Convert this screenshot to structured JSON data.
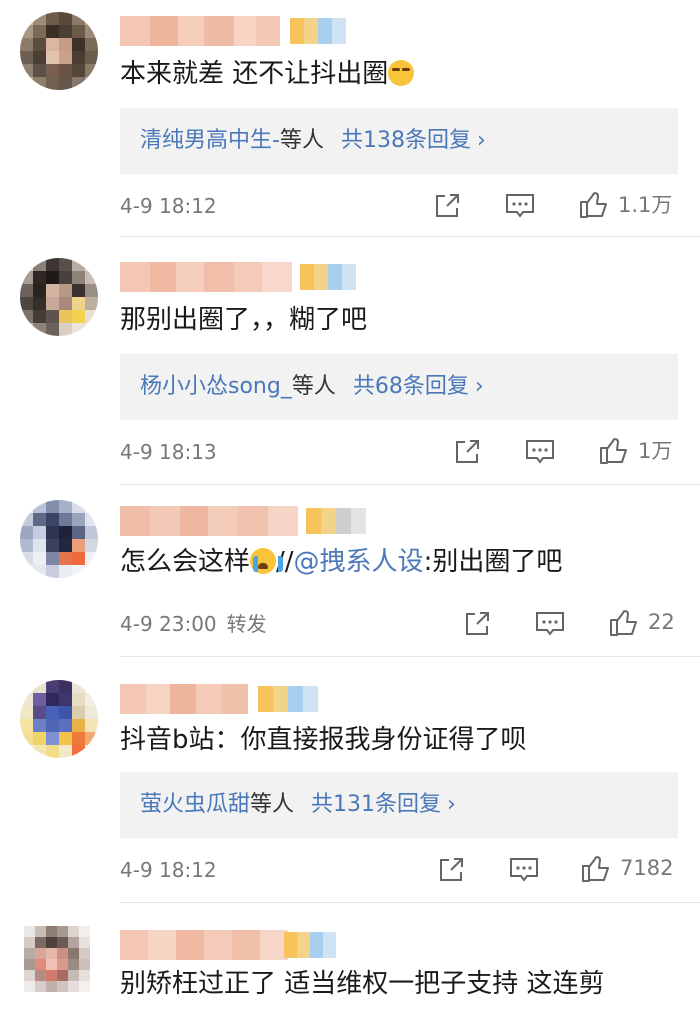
{
  "comments": [
    {
      "text": "本来就差 还不让抖出圈",
      "emoji": "smirk-emoji",
      "reply": {
        "who": "清纯男高中生-",
        "mid": "等人",
        "count": "共138条回复"
      },
      "time": "4-9 18:12",
      "likes": "1.1万"
    },
    {
      "text": "那别出圈了，，糊了吧",
      "reply": {
        "who": "杨小小怂song_",
        "mid": "等人",
        "count": "共68条回复"
      },
      "time": "4-9 18:13",
      "likes": "1万"
    },
    {
      "text_pre": "怎么会这样",
      "emoji": "crying-emoji",
      "text_sep": "//",
      "mention": "@拽系人设",
      "text_post": ":别出圈了吧",
      "time": "4-9 23:00",
      "repost": "转发",
      "likes": "22"
    },
    {
      "text": "抖音b站：你直接报我身份证得了呗",
      "reply": {
        "who": "萤火虫瓜甜",
        "mid": "等人",
        "count": "共131条回复"
      },
      "time": "4-9 18:12",
      "likes": "7182"
    },
    {
      "text": "别矫枉过正了 适当维权一把子支持 这连剪"
    }
  ],
  "chevron": "›",
  "icons": {
    "share": "share-icon",
    "comment": "comment-icon",
    "like": "thumbs-up-icon"
  },
  "colors": {
    "link": "#4a78b8",
    "reply_bg": "#f2f2f2",
    "meta": "#777777"
  }
}
